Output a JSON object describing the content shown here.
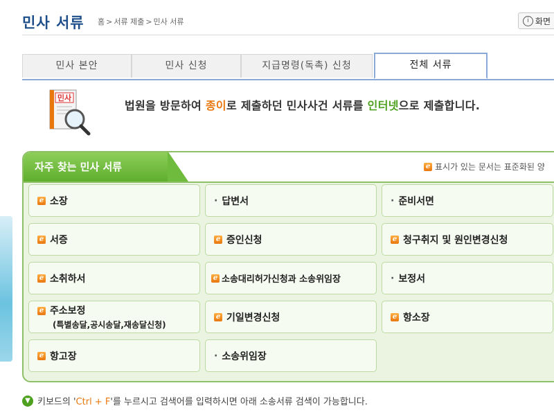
{
  "header": {
    "title": "민사 서류",
    "breadcrumb": [
      "홈",
      "서류 제출",
      "민사 서류"
    ],
    "screen_button": "화면"
  },
  "tabs": [
    {
      "label": "민사 본안",
      "active": false
    },
    {
      "label": "민사 신청",
      "active": false
    },
    {
      "label": "지급명령(독촉) 신청",
      "active": false
    },
    {
      "label": "전체 서류",
      "active": true
    }
  ],
  "intro": {
    "icon_label": "민사",
    "part1": "법원을 방문하여 ",
    "paper": "종이",
    "part2": "로 제출하던 민사사건 서류를 ",
    "internet": "인터넷",
    "part3": "으로 제출합니다."
  },
  "panel": {
    "title": "자주 찾는 민사 서류",
    "note": "표시가 있는 문서는 표준화된 양"
  },
  "documents": [
    {
      "label": "소장",
      "type": "e"
    },
    {
      "label": "답변서",
      "type": "dot"
    },
    {
      "label": "준비서면",
      "type": "dot"
    },
    {
      "label": "서증",
      "type": "e"
    },
    {
      "label": "증인신청",
      "type": "e"
    },
    {
      "label": "청구취지 및 원인변경신청",
      "type": "e"
    },
    {
      "label": "소취하서",
      "type": "e"
    },
    {
      "label": "소송대리허가신청과 소송위임장",
      "type": "e"
    },
    {
      "label": "보정서",
      "type": "dot"
    },
    {
      "label": "주소보정",
      "sub": "(특별송달,공시송달,재송달신청)",
      "type": "e"
    },
    {
      "label": "기일변경신청",
      "type": "e"
    },
    {
      "label": "항소장",
      "type": "e"
    },
    {
      "label": "항고장",
      "type": "e"
    },
    {
      "label": "소송위임장",
      "type": "dot"
    }
  ],
  "footer": {
    "part1": "키보드의 '",
    "keys": "Ctrl  + F",
    "part2": "'를 누르시고 검색어를 입력하시면 아래 소송서류 검색이 가능합니다."
  },
  "colors": {
    "green": "#8dc066",
    "orange": "#e8770e",
    "title_blue": "#1d4e89",
    "tab_border": "#8aa9d8"
  }
}
